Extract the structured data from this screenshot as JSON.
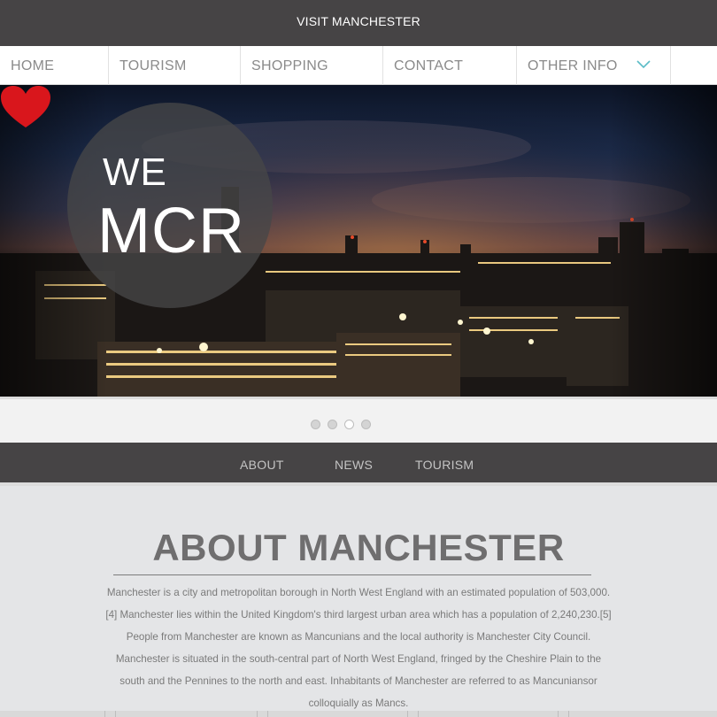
{
  "header": {
    "site_title": "VISIT MANCHESTER"
  },
  "nav": {
    "items": [
      {
        "label": "HOME"
      },
      {
        "label": "TOURISM"
      },
      {
        "label": "SHOPPING"
      },
      {
        "label": "CONTACT"
      },
      {
        "label": "OTHER INFO",
        "icon": "chevron-down-icon"
      }
    ]
  },
  "hero": {
    "logo_we": "WE",
    "logo_mcr": "MCR",
    "heart_icon": "heart-icon",
    "heart_color": "#d9161c",
    "slides_count": 4,
    "active_slide": 3
  },
  "subnav": {
    "items": [
      {
        "label": "ABOUT"
      },
      {
        "label": "NEWS"
      },
      {
        "label": "TOURISM"
      }
    ]
  },
  "about": {
    "title": "ABOUT MANCHESTER",
    "lines": [
      "Manchester is a city and metropolitan borough in North West England with an estimated population of 503,000.",
      "[4] Manchester lies within the United Kingdom's third largest urban area which has a population of 2,240,230.[5]",
      "People from Manchester are known as Mancunians and the local authority is Manchester City Council.",
      "Manchester is situated in the south-central part of North West England, fringed by the Cheshire Plain to the",
      "south and the Pennines to the north and east. Inhabitants of Manchester are referred to as Mancuniansor",
      "colloquially as Mancs."
    ]
  },
  "colors": {
    "header_bg": "#464445",
    "accent": "#5bbcc7",
    "page_bg": "#e4e5e7"
  }
}
